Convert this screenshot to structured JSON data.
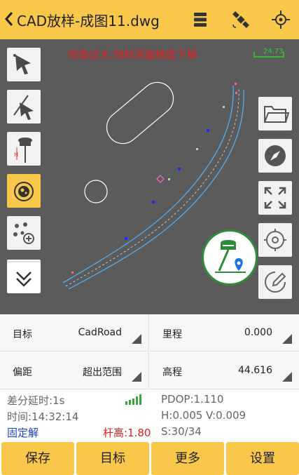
{
  "header": {
    "title": "CAD放样-成图11.dwg",
    "icons": [
      "back-icon",
      "menu-layers-icon",
      "satellite-icon",
      "target-crosshair-icon"
    ]
  },
  "map": {
    "warning": "倾角过大,倾斜测量精度下降",
    "scale_text": "24.73",
    "left_tools": [
      "select-arrow-icon",
      "select-line-icon",
      "pole-height-icon",
      "compass-tilt-icon",
      "add-point-icon",
      "expand-more-icon"
    ],
    "right_tools": [
      "folder-icon",
      "compass-icon",
      "fullscreen-icon",
      "locate-icon",
      "edit-icon"
    ],
    "gps_button_icon": "gps-receiver-location-icon"
  },
  "info": {
    "target_label": "目标",
    "target_value": "CadRoad",
    "mileage_label": "里程",
    "mileage_value": "0.000",
    "offset_label": "偏距",
    "offset_value": "超出范围",
    "elevation_label": "高程",
    "elevation_value": "44.616"
  },
  "status": {
    "diff_delay": "差分延时:1s",
    "time": "时间:14:32:14",
    "solution": "固定解",
    "pole_height": "杆高:1.80",
    "pdop": "PDOP:1.110",
    "hv": "H:0.005  V:0.009",
    "sats": "S:30/34"
  },
  "footer": {
    "save": "保存",
    "target": "目标",
    "more": "更多",
    "settings": "设置"
  },
  "colors": {
    "accent": "#f9c74a",
    "map_bg": "#5b5b5b",
    "warning": "#e02020",
    "fixed": "#1a3fd0",
    "pole": "#e02020",
    "gps_green": "#2e8b3a"
  }
}
